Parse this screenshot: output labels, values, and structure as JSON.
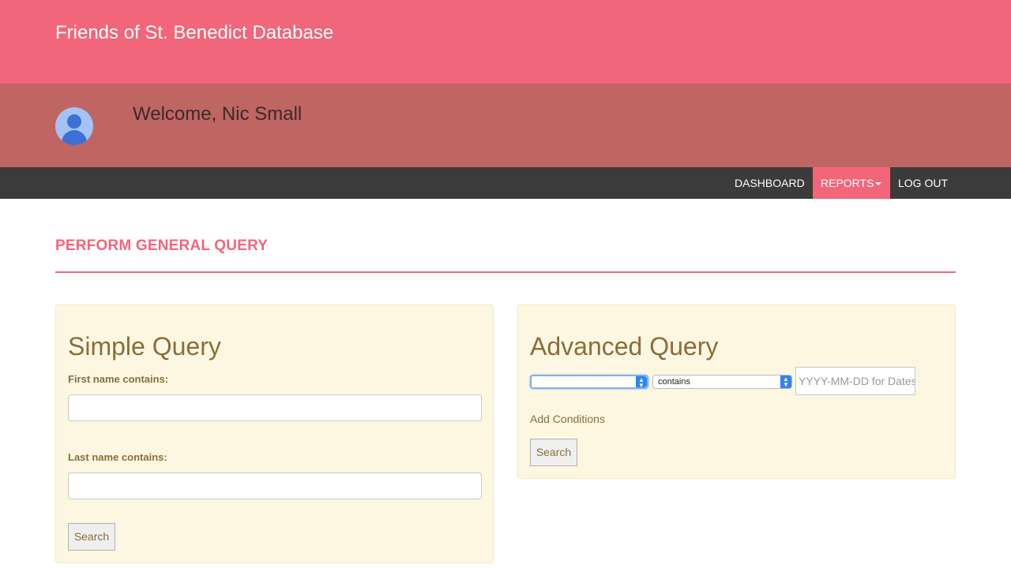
{
  "header": {
    "app_title": "Friends of St. Benedict Database",
    "welcome_text": "Welcome, Nic Small",
    "avatar_icon": "user-avatar-icon"
  },
  "nav": {
    "items": [
      {
        "label": "DASHBOARD",
        "active": false
      },
      {
        "label": "REPORTS",
        "active": true,
        "has_dropdown": true
      },
      {
        "label": "LOG OUT",
        "active": false
      }
    ]
  },
  "page": {
    "section_title": "PERFORM GENERAL QUERY"
  },
  "simple_query": {
    "title": "Simple Query",
    "first_name_label": "First name contains:",
    "first_name_value": "",
    "last_name_label": "Last name contains:",
    "last_name_value": "",
    "search_label": "Search"
  },
  "advanced_query": {
    "title": "Advanced Query",
    "field_select_value": "",
    "operator_select_value": "contains",
    "value_placeholder": "YYYY-MM-DD for Dates",
    "add_conditions_label": "Add Conditions",
    "search_label": "Search"
  },
  "colors": {
    "brand": "#f1667a",
    "welcome_bar": "#bf6562",
    "navbar": "#3b3b3b",
    "panel_bg": "#fdf7e2",
    "panel_text": "#8a6d3b"
  }
}
